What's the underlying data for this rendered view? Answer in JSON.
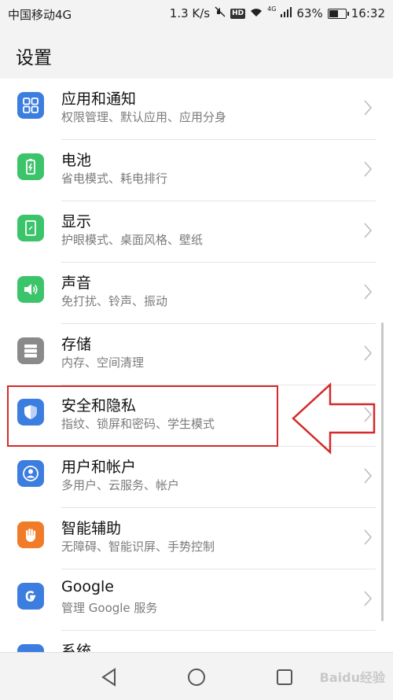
{
  "status_bar": {
    "carrier": "中国移动4G",
    "speed": "1.3 K/s",
    "hd": "HD",
    "net": "4G",
    "battery_pct": "63%",
    "battery_level": 0.63,
    "time": "16:32"
  },
  "header": {
    "title": "设置"
  },
  "settings": [
    {
      "title": "应用和通知",
      "subtitle": "权限管理、默认应用、应用分身",
      "icon": "apps-grid-icon",
      "color": "#3c7de0"
    },
    {
      "title": "电池",
      "subtitle": "省电模式、耗电排行",
      "icon": "battery-icon",
      "color": "#3cc46a"
    },
    {
      "title": "显示",
      "subtitle": "护眼模式、桌面风格、壁纸",
      "icon": "display-icon",
      "color": "#3cc46a"
    },
    {
      "title": "声音",
      "subtitle": "免打扰、铃声、振动",
      "icon": "speaker-icon",
      "color": "#3cc46a"
    },
    {
      "title": "存储",
      "subtitle": "内存、空间清理",
      "icon": "storage-icon",
      "color": "#8a8a8a"
    },
    {
      "title": "安全和隐私",
      "subtitle": "指纹、锁屏和密码、学生模式",
      "icon": "shield-icon",
      "color": "#3c7de0"
    },
    {
      "title": "用户和帐户",
      "subtitle": "多用户、云服务、帐户",
      "icon": "user-icon",
      "color": "#3c7de0"
    },
    {
      "title": "智能辅助",
      "subtitle": "无障碍、智能识屏、手势控制",
      "icon": "hand-icon",
      "color": "#f07b28"
    },
    {
      "title": "Google",
      "subtitle": "管理 Google 服务",
      "icon": "google-icon",
      "color": "#3c7de0"
    },
    {
      "title": "系统",
      "subtitle": "",
      "icon": "system-icon",
      "color": "#3c7de0"
    }
  ],
  "annotation": {
    "color": "#d42a2a"
  },
  "nav": {
    "watermark": "Baidu经验"
  }
}
